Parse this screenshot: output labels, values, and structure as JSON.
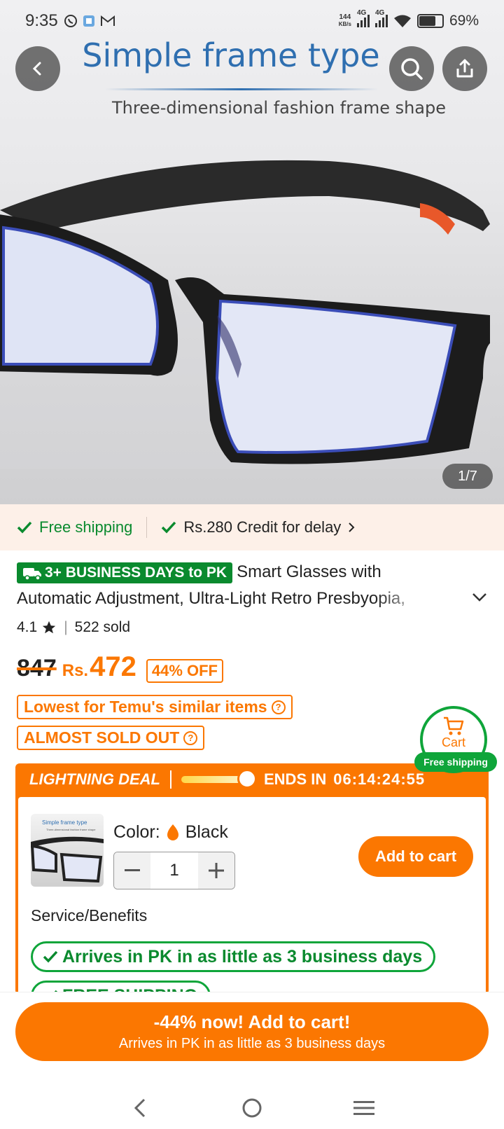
{
  "status_bar": {
    "time": "9:35",
    "net_speed_value": "144",
    "net_speed_unit": "KB/s",
    "sim1": "4G",
    "sim2": "4G",
    "battery": "69%",
    "battery_level": 0.69
  },
  "hero": {
    "title": "Simple frame type",
    "subtitle": "Three-dimensional fashion frame shape",
    "pager": "1/7"
  },
  "shipping": {
    "free": "Free shipping",
    "credit": "Rs.280 Credit for delay"
  },
  "product": {
    "badge": "3+ BUSINESS DAYS to PK",
    "title_line1": "Smart Glasses with",
    "title_line2": "Automatic Adjustment, Ultra-Light Retro Presbyopia,",
    "rating": "4.1",
    "sold": "522 sold",
    "old_price": "847",
    "currency": "Rs.",
    "price": "472",
    "discount": "44% OFF",
    "tag_lowest": "Lowest for Temu's similar items",
    "tag_soldout": "ALMOST SOLD OUT"
  },
  "cart_float": {
    "label": "Cart",
    "free": "Free shipping"
  },
  "deal": {
    "label": "LIGHTNING DEAL",
    "ends_label": "ENDS IN",
    "timer": "06:14:24:55",
    "thumb_title": "Simple frame type",
    "thumb_sub": "Three-dimensional fashion frame shape",
    "color_label": "Color:",
    "color_value": "Black",
    "quantity": "1",
    "add_to_cart": "Add to cart",
    "service_title": "Service/Benefits",
    "benefit1": "Arrives in PK in as little as 3 business days",
    "benefit2": "FREE SHIPPING"
  },
  "bottom": {
    "cta_line1": "-44% now! Add to cart!",
    "cta_line2": "Arrives in PK in as little as 3 business days"
  },
  "colors": {
    "accent": "#fb7701",
    "green": "#0fa53a",
    "hero_title": "#2f6fb0"
  }
}
